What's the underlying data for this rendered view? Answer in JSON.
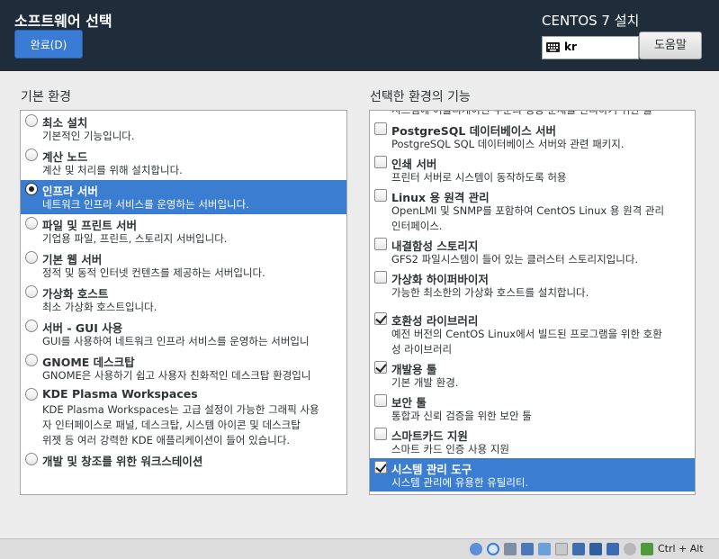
{
  "header": {
    "title": "소프트웨어 선택",
    "done_label": "완료(D)",
    "product": "CENTOS 7 설치",
    "keyboard_layout": "kr",
    "help_label": "도움말"
  },
  "base_env": {
    "heading": "기본 환경",
    "items": [
      {
        "title": "최소 설치",
        "desc": [
          "기본적인 기능입니다."
        ],
        "selected": false
      },
      {
        "title": "계산 노드",
        "desc": [
          "계산 및 처리를 위해 설치합니다."
        ],
        "selected": false
      },
      {
        "title": "인프라 서버",
        "desc": [
          "네트워크 인프라 서비스를 운영하는 서버입니다."
        ],
        "selected": true
      },
      {
        "title": "파일 및 프린트 서버",
        "desc": [
          "기업용 파일, 프린트, 스토리지 서버입니다."
        ],
        "selected": false
      },
      {
        "title": "기본 웹 서버",
        "desc": [
          "정적 및 동적 인터넷 컨텐츠를 제공하는 서버입니다."
        ],
        "selected": false
      },
      {
        "title": "가상화 호스트",
        "desc": [
          "최소 가상화 호스트입니다."
        ],
        "selected": false
      },
      {
        "title": "서버 - GUI 사용",
        "desc": [
          "GUI를 사용하여 네트워크 인프라 서비스를 운영하는 서버입니"
        ],
        "selected": false
      },
      {
        "title": "GNOME 데스크탑",
        "desc": [
          "GNOME은 사용하기 쉽고 사용자 친화적인 데스크탑 환경입니"
        ],
        "selected": false
      },
      {
        "title": "KDE Plasma Workspaces",
        "desc": [
          "KDE Plasma Workspaces는 고급 설정이 가능한 그래픽 사용",
          "자 인터페이스로 패널, 데스크탑, 시스템 아이콘 및 데스크탑",
          "위젯 등 여러 강력한 KDE 애플리케이션이 들어 있습니다."
        ],
        "selected": false
      },
      {
        "title": "개발 및 창조를 위한 워크스테이션",
        "desc": [],
        "selected": false
      }
    ]
  },
  "addons": {
    "heading": "선택한 환경의 기능",
    "partial_top": "시스템에 어플리케이션 수준의 성능 문제를 관리하기 위한 툴",
    "items": [
      {
        "title": "PostgreSQL 데이터베이스 서버",
        "desc": [
          "PostgreSQL SQL 데이터베이스 서버와 관련 패키지."
        ],
        "checked": false,
        "selected": false
      },
      {
        "title": "인쇄 서버",
        "desc": [
          "프린터 서버로 시스템이 동작하도록 허용"
        ],
        "checked": false,
        "selected": false
      },
      {
        "title": "Linux 용 원격 관리",
        "desc": [
          "OpenLMI 및 SNMP를 포함하여 CentOS Linux 용 원격 관리",
          "인터페이스."
        ],
        "checked": false,
        "selected": false
      },
      {
        "title": "내결함성 스토리지",
        "desc": [
          "GFS2 파일시스템이 들어 있는 클러스터 스토리지입니다."
        ],
        "checked": false,
        "selected": false
      },
      {
        "title": "가상화 하이퍼바이저",
        "desc": [
          "가능한 최소한의 가상화 호스트를 설치합니다."
        ],
        "checked": false,
        "selected": false
      },
      {
        "title": "호환성 라이브러리",
        "desc": [
          "예전 버전의 CentOS Linux에서 빌드된 프로그램을 위한 호환",
          "성 라이브러리"
        ],
        "checked": true,
        "selected": false
      },
      {
        "title": "개발용 툴",
        "desc": [
          "기본 개발 환경."
        ],
        "checked": true,
        "selected": false
      },
      {
        "title": "보안 툴",
        "desc": [
          "통합과 신뢰 검증을 위한 보안 툴"
        ],
        "checked": false,
        "selected": false
      },
      {
        "title": "스마트카드 지원",
        "desc": [
          "스마트 카드 인증 사용 지원"
        ],
        "checked": false,
        "selected": false
      },
      {
        "title": "시스템 관리 도구",
        "desc": [
          "시스템 관리에 유용한 유틸리티."
        ],
        "checked": true,
        "selected": true
      }
    ]
  },
  "taskbar": {
    "hostkey": "Ctrl + Alt"
  }
}
